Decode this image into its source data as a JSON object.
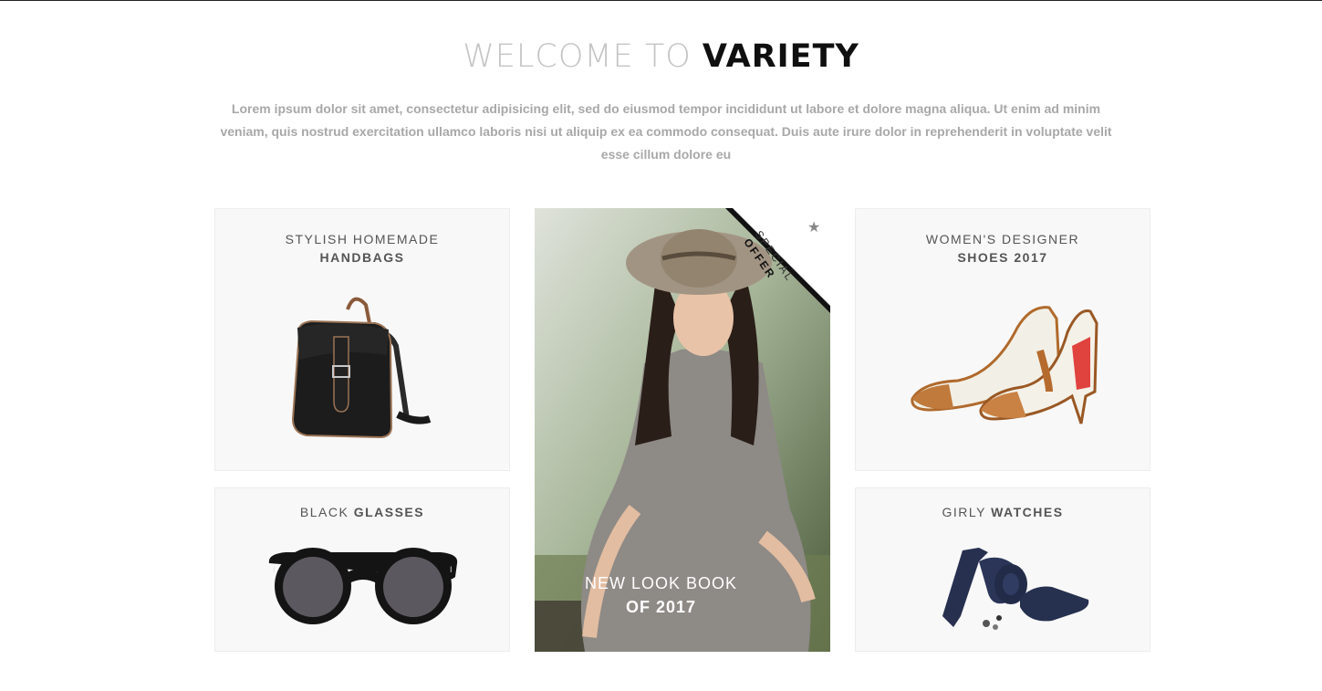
{
  "welcome": {
    "prefix": "WELCOME TO",
    "brand": "VARIETY"
  },
  "intro_text": "Lorem ipsum dolor sit amet, consectetur adipisicing elit, sed do eiusmod tempor incididunt ut labore et dolore magna aliqua. Ut enim ad minim veniam, quis nostrud exercitation ullamco laboris nisi ut aliquip ex ea commodo consequat. Duis aute irure dolor in reprehenderit in voluptate velit esse cillum dolore eu",
  "cards": {
    "handbags": {
      "line1": "STYLISH HOMEMADE",
      "line2": "HANDBAGS"
    },
    "shoes": {
      "line1": "WOMEN'S DESIGNER",
      "line2": "SHOES 2017"
    },
    "glasses": {
      "light": "BLACK",
      "bold": "GLASSES"
    },
    "watches": {
      "light": "GIRLY",
      "bold": "WATCHES"
    }
  },
  "feature": {
    "caption_line1": "NEW LOOK BOOK",
    "caption_line2": "OF 2017",
    "badge_line1": "SPECIAL",
    "badge_line2": "OFFER"
  },
  "colors": {
    "heading_light": "#c4c4c4",
    "heading_dark": "#0f0f0f",
    "body_text": "#a8a8a8",
    "card_bg": "#f8f8f8"
  },
  "icons": [
    "handbag-image",
    "shoes-image",
    "glasses-image",
    "tie-image",
    "star-icon"
  ]
}
